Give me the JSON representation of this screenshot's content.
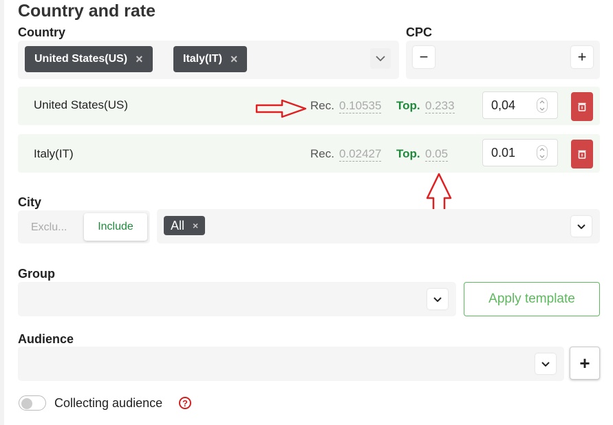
{
  "header": {
    "title": "Country and rate"
  },
  "country": {
    "label": "Country",
    "chips": [
      {
        "label": "United States(US)",
        "remove": "×"
      },
      {
        "label": "Italy(IT)",
        "remove": "×"
      }
    ]
  },
  "cpc": {
    "label": "CPC",
    "minus": "−",
    "plus": "+"
  },
  "rows": [
    {
      "name": "United States(US)",
      "rec_label": "Rec.",
      "rec_value": "0.10535",
      "top_label": "Top.",
      "top_value": "0.233",
      "bid": "0,04"
    },
    {
      "name": "Italy(IT)",
      "rec_label": "Rec.",
      "rec_value": "0.02427",
      "top_label": "Top.",
      "top_value": "0.05",
      "bid": "0.01"
    }
  ],
  "city": {
    "label": "City",
    "exclude_label": "Exclu...",
    "include_label": "Include",
    "chips": [
      {
        "label": "All",
        "remove": "×"
      }
    ]
  },
  "group": {
    "label": "Group",
    "apply_label": "Apply template"
  },
  "audience": {
    "label": "Audience",
    "add": "+"
  },
  "collecting": {
    "label": "Collecting audience",
    "help": "?"
  },
  "colors": {
    "accent_green": "#1f8a3c",
    "danger": "#d04545",
    "chip_bg": "#4a4d52",
    "annotation_red": "#e02020"
  }
}
